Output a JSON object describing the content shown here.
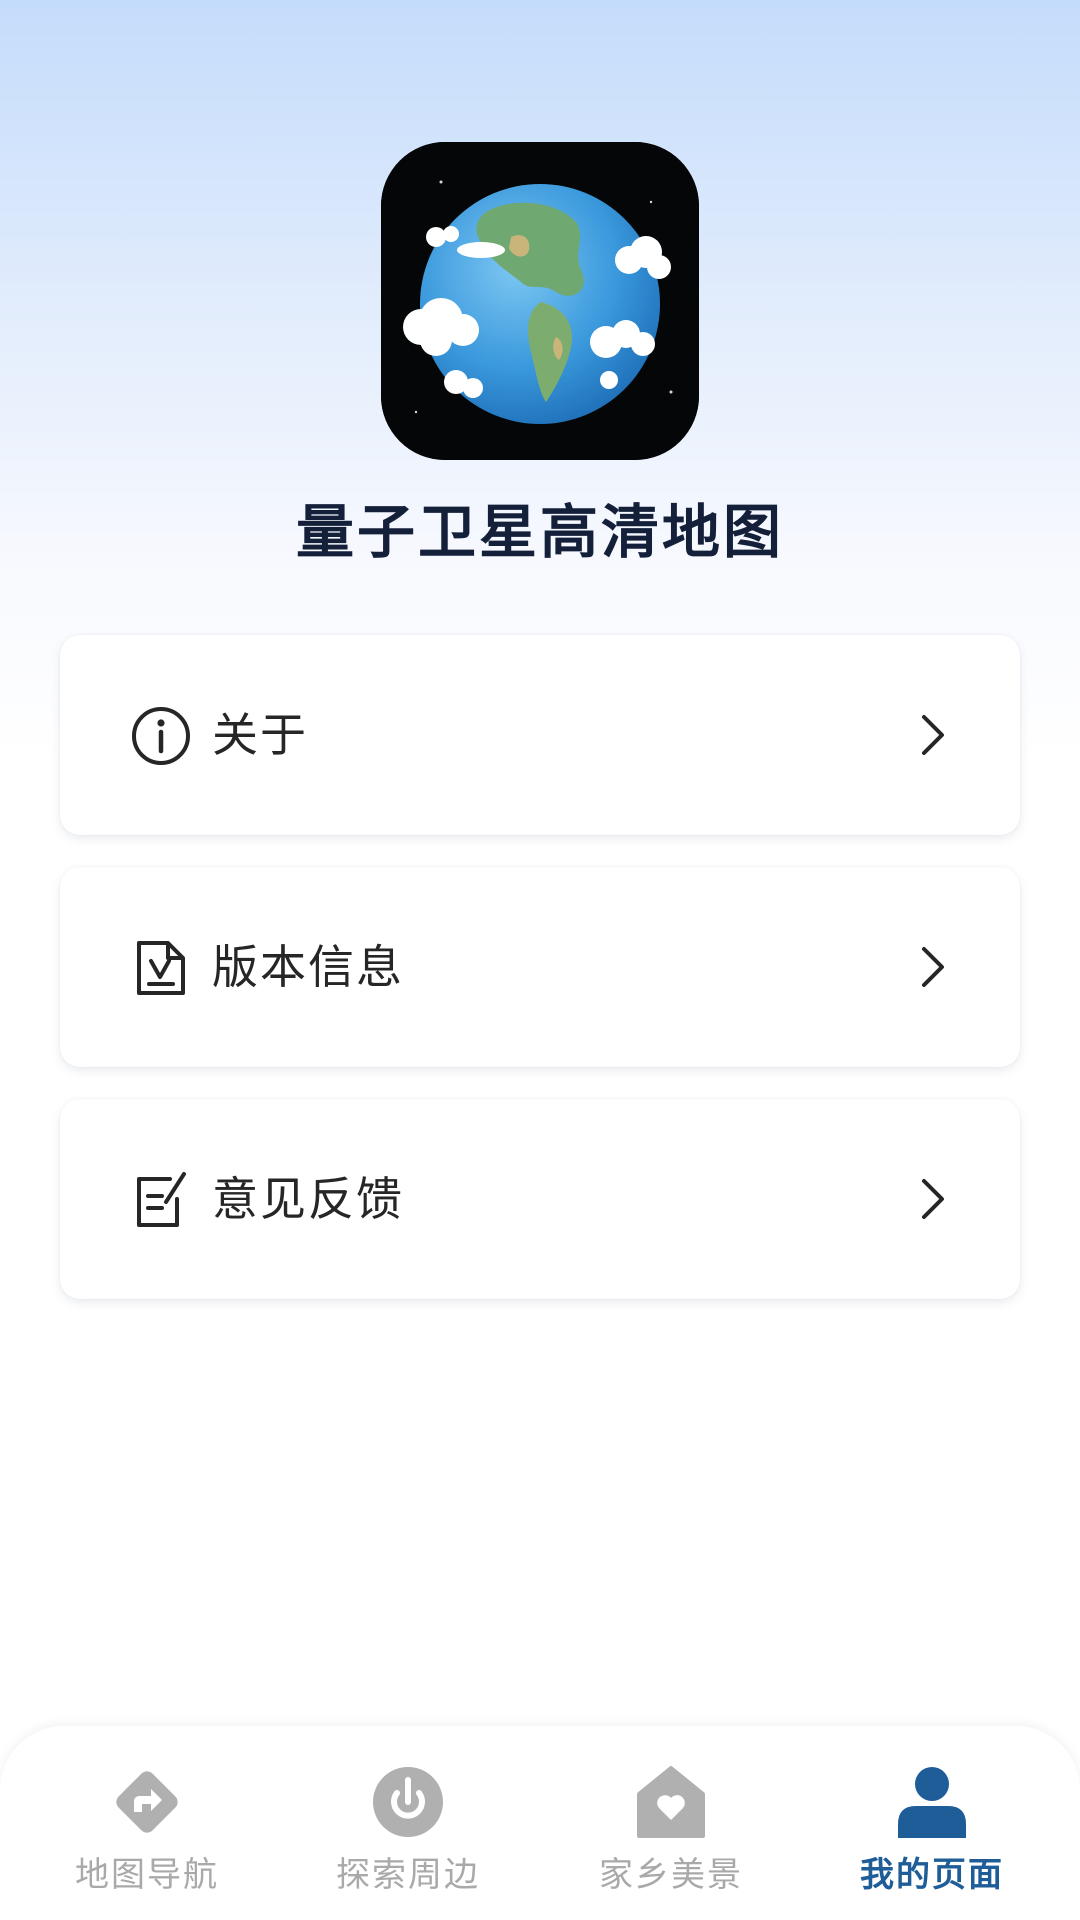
{
  "app": {
    "title": "量子卫星高清地图"
  },
  "menu": [
    {
      "label": "关于",
      "icon": "info-circle-icon"
    },
    {
      "label": "版本信息",
      "icon": "document-version-icon"
    },
    {
      "label": "意见反馈",
      "icon": "feedback-edit-icon"
    }
  ],
  "tabs": [
    {
      "label": "地图导航",
      "icon": "navigation-arrow-icon",
      "active": false
    },
    {
      "label": "探索周边",
      "icon": "compass-icon",
      "active": false
    },
    {
      "label": "家乡美景",
      "icon": "home-heart-icon",
      "active": false
    },
    {
      "label": "我的页面",
      "icon": "person-icon",
      "active": true
    }
  ],
  "colors": {
    "title": "#141f3a",
    "tab_active": "#1f5d98",
    "tab_inactive": "#a9a9a9",
    "background_top": "#c4dcfb"
  }
}
